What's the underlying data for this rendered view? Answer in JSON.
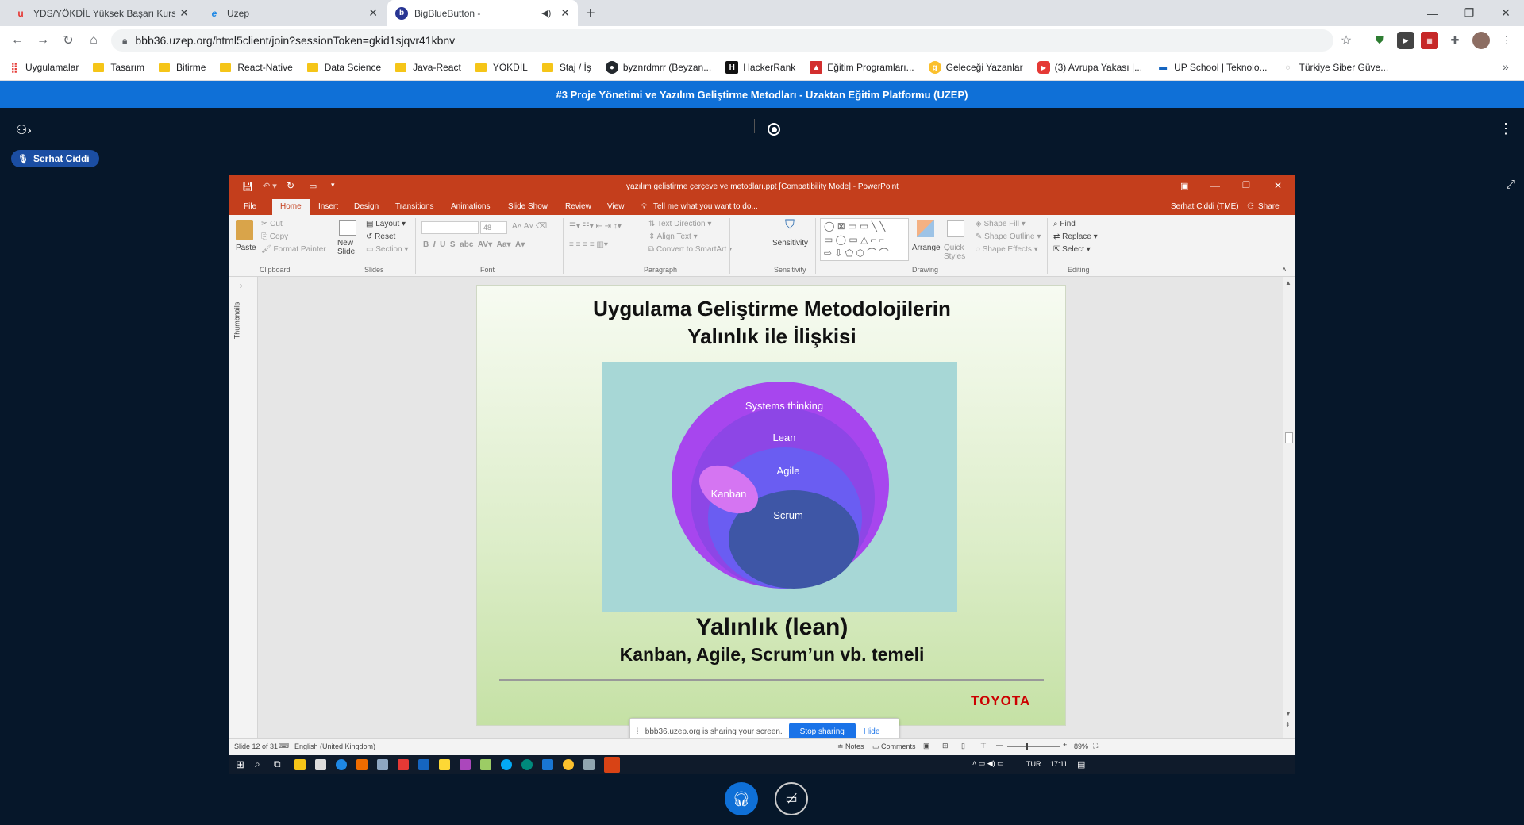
{
  "browser": {
    "tabs": [
      {
        "label": "YDS/YÖKDİL Yüksek Başarı Kursu",
        "icon": "u"
      },
      {
        "label": "Uzep",
        "icon": "e"
      },
      {
        "label": "BigBlueButton -",
        "icon": "b"
      }
    ],
    "new_tab": "+",
    "url": "bbb36.uzep.org/html5client/join?sessionToken=gkid1sjqvr41kbnv",
    "bookmarks": [
      {
        "label": "Uygulamalar",
        "type": "apps"
      },
      {
        "label": "Tasarım",
        "type": "folder"
      },
      {
        "label": "Bitirme",
        "type": "folder"
      },
      {
        "label": "React-Native",
        "type": "folder"
      },
      {
        "label": "Data Science",
        "type": "folder"
      },
      {
        "label": "Java-React",
        "type": "folder"
      },
      {
        "label": "YÖKDİL",
        "type": "folder"
      },
      {
        "label": "Staj / İş",
        "type": "folder"
      },
      {
        "label": "byznrdmrr (Beyzan...",
        "type": "github"
      },
      {
        "label": "HackerRank",
        "type": "hackerrank"
      },
      {
        "label": "Eğitim Programları...",
        "type": "red"
      },
      {
        "label": "Geleceği Yazanlar",
        "type": "yellow"
      },
      {
        "label": "(3) Avrupa Yakası |...",
        "type": "youtube"
      },
      {
        "label": "UP School | Teknolo...",
        "type": "blue"
      },
      {
        "label": "Türkiye Siber Güve...",
        "type": "grey"
      }
    ],
    "more": "»"
  },
  "bbb": {
    "meeting_title": "#3 Proje Yönetimi ve Yazılım Geliştirme Metodları - Uzaktan Eğitim Platformu (UZEP)",
    "user_name": "Serhat Ciddi",
    "more_icon": "⋮"
  },
  "ppt": {
    "window_title": "yazılım geliştirme çerçeve ve metodları.ppt [Compatibility Mode] - PowerPoint",
    "account": "Serhat Ciddi (TME)",
    "share_label": "Share",
    "menu": [
      "File",
      "Home",
      "Insert",
      "Design",
      "Transitions",
      "Animations",
      "Slide Show",
      "Review",
      "View"
    ],
    "tell_me": "Tell me what you want to do...",
    "ribbon": {
      "paste": "Paste",
      "cut": "Cut",
      "copy": "Copy",
      "format_painter": "Format Painter",
      "new_slide": "New Slide",
      "layout": "Layout",
      "reset": "Reset",
      "section": "Section",
      "font_size": "48",
      "text_direction": "Text Direction",
      "align_text": "Align Text",
      "convert_smartart": "Convert to SmartArt",
      "sensitivity": "Sensitivity",
      "arrange": "Arrange",
      "quick_styles": "Quick Styles",
      "shape_fill": "Shape Fill",
      "shape_outline": "Shape Outline",
      "shape_effects": "Shape Effects",
      "find": "Find",
      "replace": "Replace",
      "select": "Select",
      "groups": [
        "Clipboard",
        "Slides",
        "Font",
        "Paragraph",
        "Sensitivity",
        "Drawing",
        "Editing"
      ]
    },
    "thumbnails_label": "Thumbnails",
    "slide": {
      "title_line1": "Uygulama Geliştirme Metodolojilerin",
      "title_line2": "Yalınlık ile İlişkisi",
      "circles": [
        "Systems thinking",
        "Lean",
        "Agile",
        "Kanban",
        "Scrum"
      ],
      "subtitle1": "Yalınlık (lean)",
      "subtitle2": "Kanban, Agile, Scrum’un vb. temeli",
      "logo": "TOYOTA"
    },
    "status": {
      "slide_of": "Slide 12 of 31",
      "language": "English (United Kingdom)",
      "notes": "Notes",
      "comments": "Comments",
      "zoom": "89%"
    },
    "taskbar": {
      "lang": "TUR",
      "time": "17:11"
    }
  },
  "share_banner": {
    "text": "bbb36.uzep.org is sharing your screen.",
    "stop": "Stop sharing",
    "hide": "Hide"
  },
  "colors": {
    "ppt_orange": "#c43e1c",
    "bbb_blue": "#0f70d7",
    "bbb_bg": "#06172a",
    "circle_outer": "#a746ee",
    "circle_lean": "#8d46e6",
    "circle_agile": "#6a5df2",
    "circle_scrum": "#3e56a6",
    "circle_kanban": "#d575f2"
  }
}
